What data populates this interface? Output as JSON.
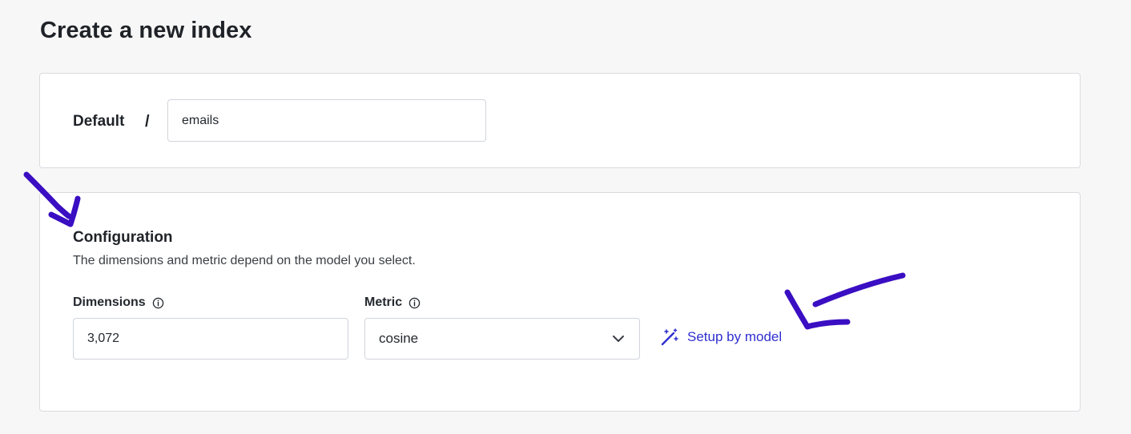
{
  "page": {
    "title": "Create a new index"
  },
  "name_section": {
    "project_label": "Default",
    "separator": "/",
    "index_name_value": "emails"
  },
  "configuration": {
    "title": "Configuration",
    "description": "The dimensions and metric depend on the model you select.",
    "dimensions": {
      "label": "Dimensions",
      "value": "3,072",
      "info_icon": "info-icon"
    },
    "metric": {
      "label": "Metric",
      "selected": "cosine",
      "info_icon": "info-icon",
      "dropdown_icon": "chevron-down-icon"
    },
    "setup_link": {
      "label": "Setup by model",
      "icon": "magic-wand-icon"
    }
  },
  "colors": {
    "link": "#2f2fd0",
    "annotation_ink": "#3a0ec2",
    "border": "#d8dbe0",
    "background": "#f7f7f7"
  }
}
